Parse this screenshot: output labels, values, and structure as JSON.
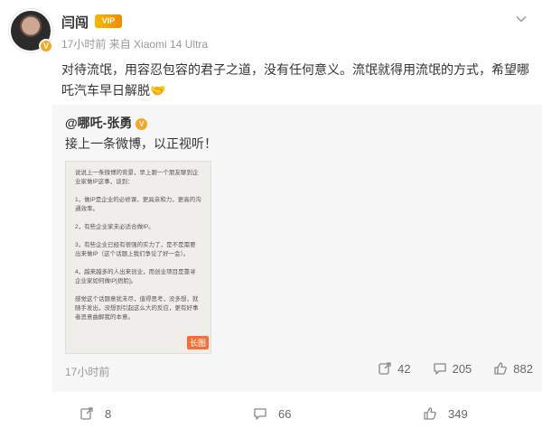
{
  "header": {
    "username": "闫闯",
    "vip_label": "VIP",
    "time": "17小时前",
    "source": "来自 Xiaomi 14 Ultra"
  },
  "post": {
    "text": "对待流氓，用容忍包容的君子之道，没有任何意义。流氓就得用流氓的方式，希望哪吒汽车早日解脱🤝"
  },
  "repost": {
    "author": "@哪吒-张勇",
    "text": "接上一条微博，以正视听！",
    "long_image_text": "说说上一条微博的背景，早上跟一个朋友聊到企业家做IP这事，谈到：\n\n1，做IP是企业的必修课，更具亲和力，更高的沟通效率。\n\n2，有些企业家未必适合做IP。\n\n3，有些企业已经有很强的实力了，是不是需要出来做IP（这个话题上我们争论了好一会）。\n\n4，越来越多的人出来创业，而创业项目是靠寻企业家如何做IP[捂脸]。\n\n感觉这个话题意犹未尽，值得思考，没多想，就随手发出，没想到引起这么大的反应，更有好事者恶意曲解我的本意。",
    "long_image_tag": "长图",
    "time": "17小时前",
    "reposts": "42",
    "comments": "205",
    "likes": "882"
  },
  "actions": {
    "reposts": "8",
    "comments": "66",
    "likes": "349"
  },
  "colors": {
    "badge": "#f5a623",
    "tag": "#f36f3a",
    "repost_bg": "#f7f7f7"
  }
}
